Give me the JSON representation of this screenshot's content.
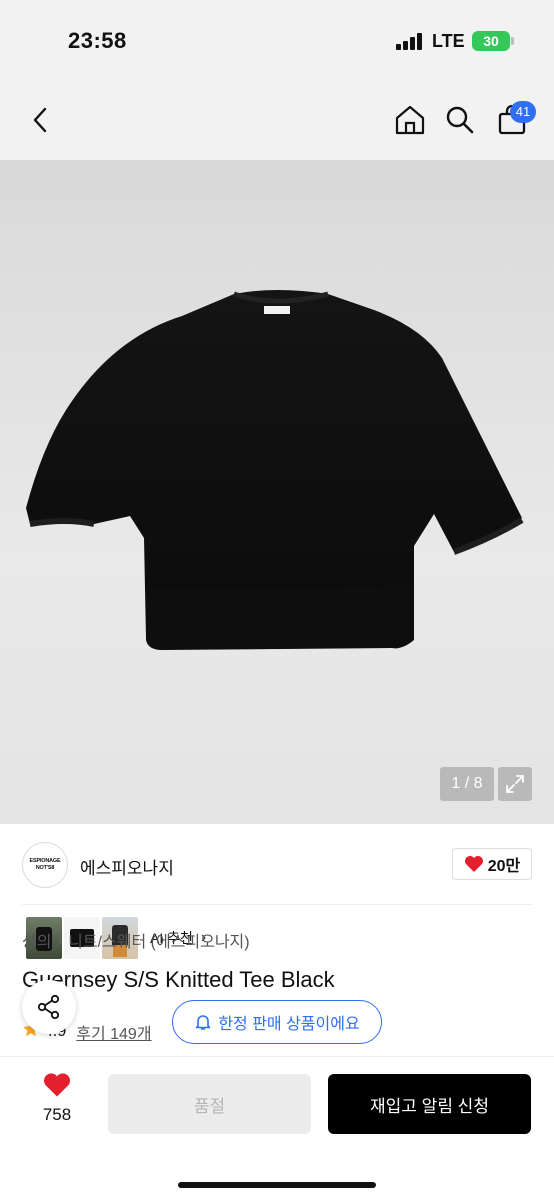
{
  "status_bar": {
    "time": "23:58",
    "network": "LTE",
    "battery": "30"
  },
  "nav": {
    "back_icon": "chevron-left-icon",
    "home_icon": "home-icon",
    "search_icon": "search-icon",
    "cart_icon": "shopping-bag-icon",
    "cart_count": "41"
  },
  "gallery": {
    "ai_label": "AI 추천",
    "page_indicator": "1 / 8"
  },
  "brand": {
    "logo_text_1": "ESPIONAGE",
    "logo_text_2": "NOT'S8",
    "name": "에스피오나지",
    "likes": "20만"
  },
  "breadcrumb": {
    "root": "상의",
    "leaf": "니트/스웨터 (에스피오나지)"
  },
  "product": {
    "title": "Guernsey S/S Knitted Tee Black",
    "rating": "4.9",
    "reviews": "후기 149개",
    "limited_notice": "한정 판매 상품이에요"
  },
  "bottom": {
    "wish_count": "758",
    "soldout_label": "품절",
    "restock_label": "재입고 알림 신청"
  },
  "colors": {
    "accent": "#2f6ff1",
    "heart": "#e5202e",
    "battery": "#34c759"
  }
}
